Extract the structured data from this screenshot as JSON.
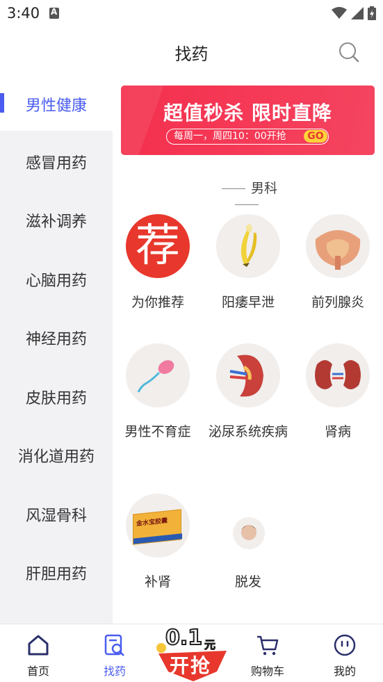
{
  "status": {
    "time": "3:40"
  },
  "header": {
    "title": "找药"
  },
  "sidebar": {
    "items": [
      {
        "label": "男性健康"
      },
      {
        "label": "感冒用药"
      },
      {
        "label": "滋补调养"
      },
      {
        "label": "心脑用药"
      },
      {
        "label": "神经用药"
      },
      {
        "label": "皮肤用药"
      },
      {
        "label": "消化道用药"
      },
      {
        "label": "风湿骨科"
      },
      {
        "label": "肝胆用药"
      }
    ]
  },
  "banner": {
    "headline": "超值秒杀 限时直降",
    "sub": "每周一，周四10：00开抢",
    "go": "GO"
  },
  "section": {
    "title": "男科",
    "categories": [
      {
        "label": "为你推荐",
        "icon": "recommend-icon",
        "glyph": "荐"
      },
      {
        "label": "阳痿早泄",
        "icon": "banana-icon"
      },
      {
        "label": "前列腺炎",
        "icon": "prostate-icon"
      },
      {
        "label": "男性不育症",
        "icon": "sperm-icon"
      },
      {
        "label": "泌尿系统疾病",
        "icon": "kidney-section-icon"
      },
      {
        "label": "肾病",
        "icon": "kidneys-icon"
      },
      {
        "label": "补肾",
        "icon": "medicine-box-icon",
        "box_text": "金水宝胶囊"
      },
      {
        "label": "脱发",
        "icon": "hair-loss-icon"
      }
    ]
  },
  "bottom_nav": {
    "items": [
      {
        "label": "首页"
      },
      {
        "label": "找药"
      },
      {
        "label": "购物车"
      },
      {
        "label": "我的"
      }
    ],
    "promo": {
      "price": "0.1",
      "unit": "元",
      "action": "开抢"
    }
  },
  "colors": {
    "accent": "#4a5cf0",
    "banner": "#f53a57",
    "promo": "#e8372c"
  }
}
